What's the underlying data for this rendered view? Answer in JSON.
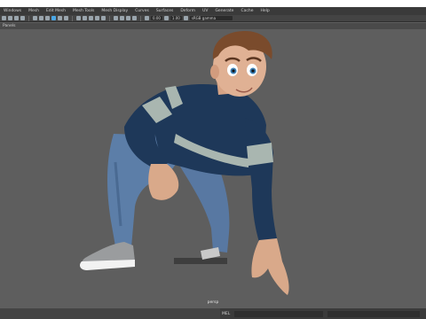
{
  "menubar": {
    "items": [
      "Windows",
      "Mesh",
      "Edit Mesh",
      "Mesh Tools",
      "Mesh Display",
      "Curves",
      "Surfaces",
      "Deform",
      "UV",
      "Generate",
      "Cache",
      "Help"
    ]
  },
  "toolbar": {
    "field1": "0.00",
    "field2": "1.00",
    "colorspace": "sRGB gamma"
  },
  "panel": {
    "label": "Panels"
  },
  "viewport": {
    "camera_label": "persp"
  },
  "statusbar": {
    "mel_label": "MEL"
  },
  "colors": {
    "background": "#5e5e5e",
    "menubar": "#3a3a3a",
    "accent": "#4aa7e6",
    "sweater_navy": "#1e3859",
    "sweater_stripe": "#a9b6b0",
    "jeans": "#5c7ea8"
  }
}
